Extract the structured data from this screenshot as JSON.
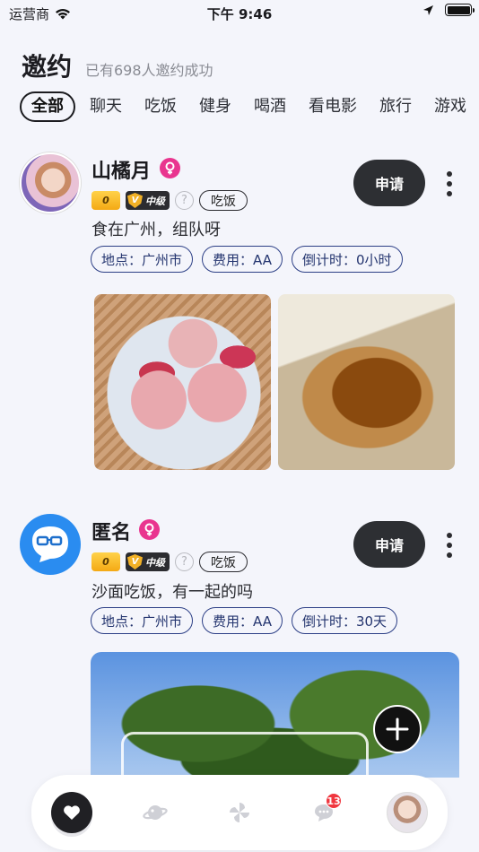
{
  "status_bar": {
    "carrier": "运营商",
    "time": "下午 9:46"
  },
  "header": {
    "title": "邀约",
    "subtitle": "已有698人邀约成功"
  },
  "tabs": [
    {
      "label": "全部",
      "active": true
    },
    {
      "label": "聊天"
    },
    {
      "label": "吃饭"
    },
    {
      "label": "健身"
    },
    {
      "label": "喝酒"
    },
    {
      "label": "看电影"
    },
    {
      "label": "旅行"
    },
    {
      "label": "游戏"
    }
  ],
  "posts": [
    {
      "username": "山橘月",
      "gender": "female",
      "level_badge": "0",
      "rank_badge": "中级",
      "help": "?",
      "category": "吃饭",
      "apply_label": "申请",
      "text": "食在广州，组队呀",
      "location": "地点：广州市",
      "cost": "费用：AA",
      "countdown": "倒计时：0小时",
      "images": [
        "dumplings-photo",
        "tofu-photo"
      ]
    },
    {
      "username": "匿名",
      "gender": "female",
      "level_badge": "0",
      "rank_badge": "中级",
      "help": "?",
      "category": "吃饭",
      "apply_label": "申请",
      "text": "沙面吃饭，有一起的吗",
      "location": "地点：广州市",
      "cost": "费用：AA",
      "countdown": "倒计时：30天",
      "images": [
        "tree-photo"
      ]
    }
  ],
  "bottom_nav": {
    "items": [
      "heart-icon",
      "planet-icon",
      "pinwheel-icon",
      "chat-icon",
      "profile-avatar"
    ],
    "message_badge": "13"
  },
  "colors": {
    "accent_dark": "#2d2f33",
    "chip_blue": "#2c3f86",
    "female_pink": "#e9358f",
    "badge_red": "#f0373f"
  }
}
